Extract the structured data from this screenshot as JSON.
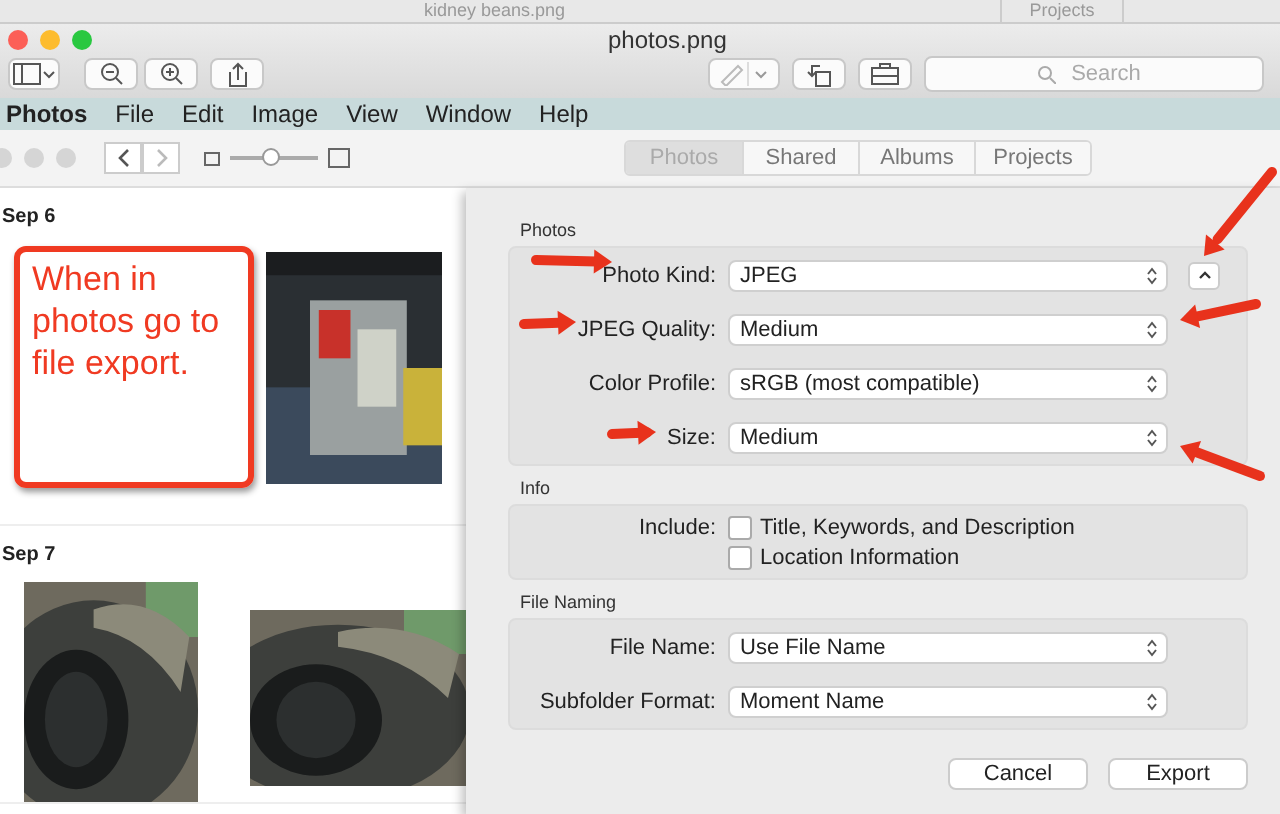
{
  "background_window": {
    "title": "kidney beans.png",
    "tab": "Projects"
  },
  "window": {
    "title": "photos.png"
  },
  "toolbar": {
    "search": {
      "placeholder": "Search"
    }
  },
  "menu_bar": [
    {
      "label": "Photos",
      "selected": true
    },
    {
      "label": "File",
      "selected": false
    },
    {
      "label": "Edit",
      "selected": false
    },
    {
      "label": "Image",
      "selected": false
    },
    {
      "label": "View",
      "selected": false
    },
    {
      "label": "Window",
      "selected": false
    },
    {
      "label": "Help",
      "selected": false
    }
  ],
  "photos_toolbar": {
    "zoom_slider": {
      "level": 0.45
    },
    "tabs": [
      {
        "label": "Photos",
        "selected": true
      },
      {
        "label": "Shared",
        "selected": false
      },
      {
        "label": "Albums",
        "selected": false
      },
      {
        "label": "Projects",
        "selected": false
      }
    ]
  },
  "moments": [
    {
      "date": "Sep 6",
      "note": "When in photos go to file export.",
      "items": [
        {
          "kind": "note"
        },
        {
          "kind": "picture"
        }
      ]
    },
    {
      "date": "Sep 7",
      "items": [
        {
          "kind": "picture"
        },
        {
          "kind": "picture"
        }
      ]
    }
  ],
  "export_dialog": {
    "sections": [
      {
        "title": "Photos",
        "rows": [
          {
            "label": "Photo Kind:",
            "kind": "select",
            "value": "JPEG",
            "extra_button": true
          },
          {
            "label": "JPEG Quality:",
            "kind": "select",
            "value": "Medium"
          },
          {
            "label": "Color Profile:",
            "kind": "select",
            "value": "sRGB (most compatible)"
          },
          {
            "label": "Size:",
            "kind": "select",
            "value": "Medium"
          }
        ]
      },
      {
        "title": "Info",
        "rows": [
          {
            "label": "Include:",
            "kind": "checkbox",
            "value": "Title, Keywords, and Description",
            "checked": false
          },
          {
            "kind": "checkbox",
            "value": "Location Information",
            "checked": false
          }
        ]
      },
      {
        "title": "File Naming",
        "rows": [
          {
            "label": "File Name:",
            "kind": "select",
            "value": "Use File Name"
          },
          {
            "label": "Subfolder Format:",
            "kind": "select",
            "value": "Moment Name"
          }
        ]
      }
    ],
    "buttons": [
      {
        "label": "Cancel"
      },
      {
        "label": "Export"
      }
    ]
  }
}
